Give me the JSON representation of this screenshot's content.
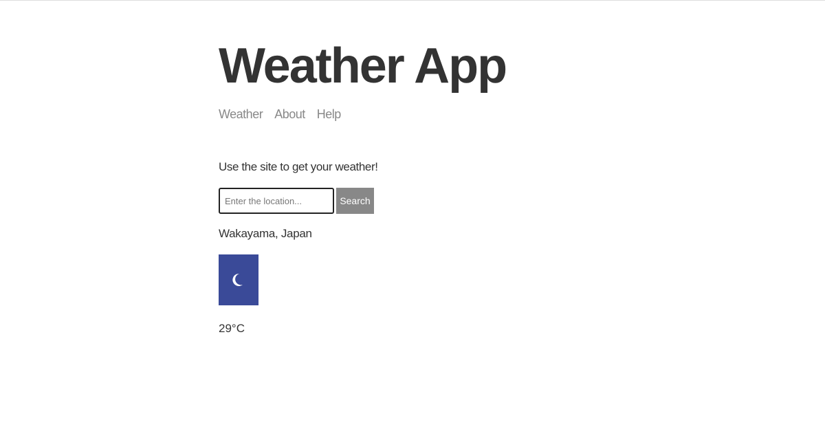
{
  "app": {
    "title": "Weather App"
  },
  "nav": {
    "items": [
      "Weather",
      "About",
      "Help"
    ]
  },
  "main": {
    "tagline": "Use the site to get your weather!"
  },
  "search": {
    "placeholder": "Enter the location...",
    "value": "",
    "button_label": "Search"
  },
  "result": {
    "location": "Wakayama, Japan",
    "icon": "crescent-moon-icon",
    "icon_background": "#3a4a98",
    "temperature": "29°C"
  },
  "colors": {
    "text": "#333333",
    "nav_link": "#888888",
    "button_bg": "#888888",
    "button_text": "#ffffff"
  }
}
